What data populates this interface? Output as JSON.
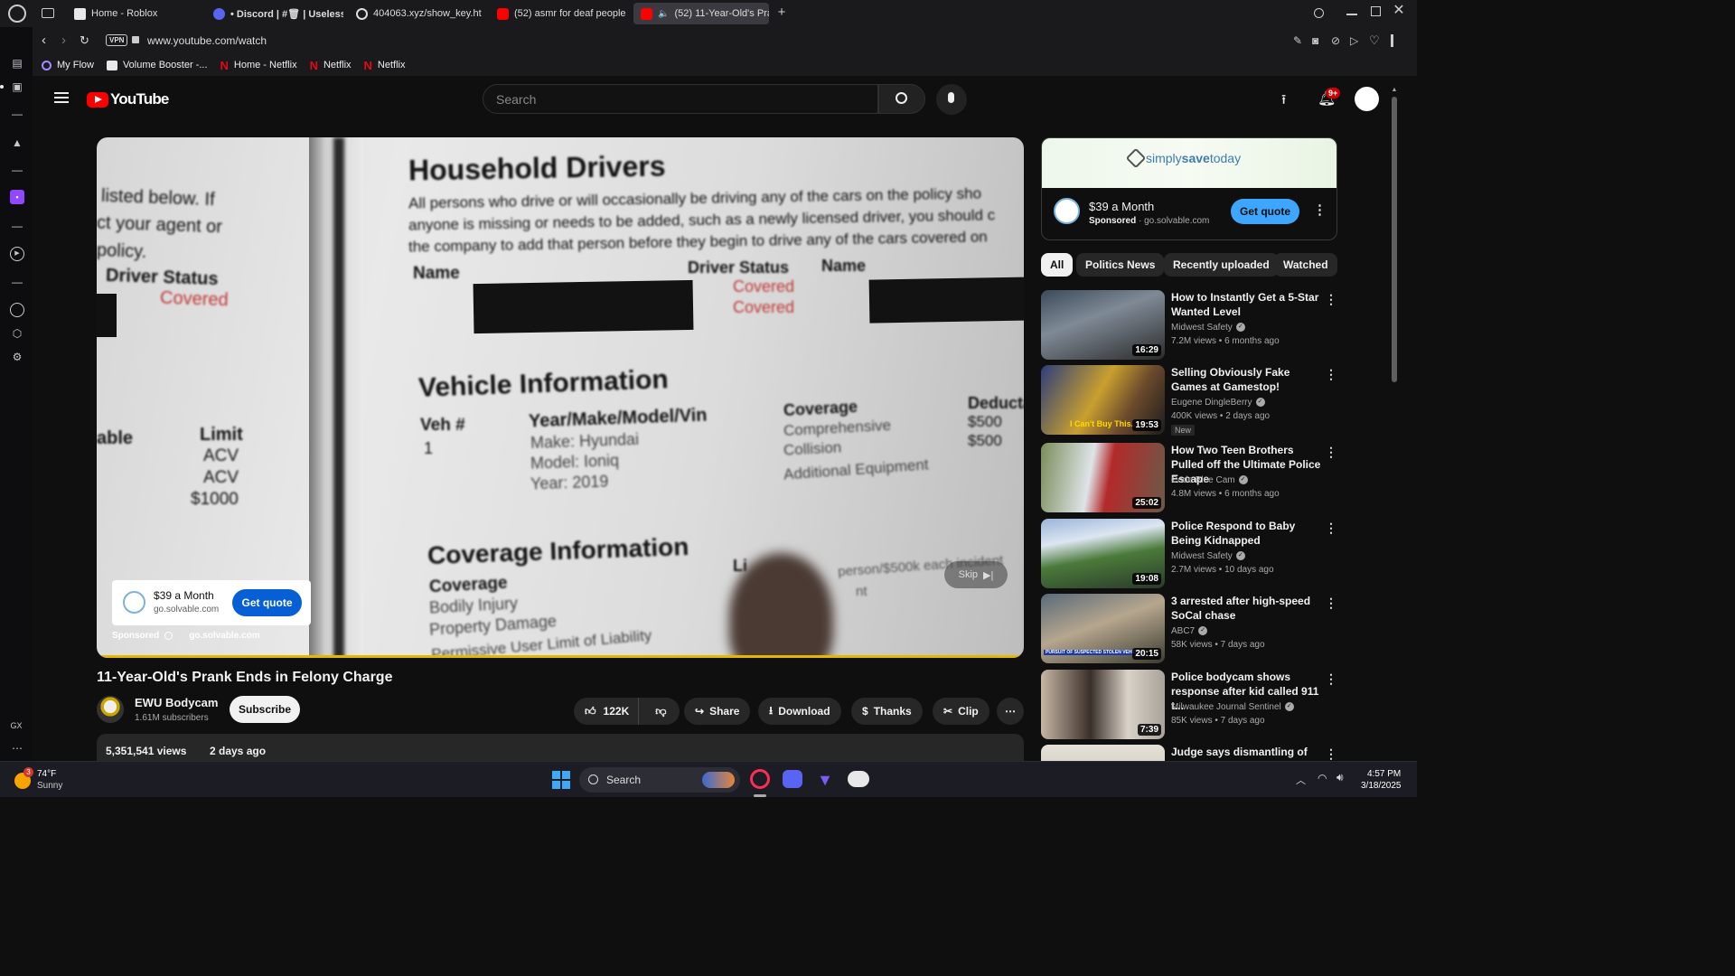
{
  "browser": {
    "tabs": [
      {
        "title": "Home - Roblox"
      },
      {
        "title": "• Discord | #🗑 | Useless-"
      },
      {
        "title": "404063.xyz/show_key.ht"
      },
      {
        "title": "(52) asmr for deaf people"
      },
      {
        "title": "(52) 11-Year-Old's Pra"
      }
    ],
    "address": "www.youtube.com/watch",
    "vpn_label": "VPN",
    "bookmarks": [
      {
        "label": "My Flow"
      },
      {
        "label": "Volume Booster -..."
      },
      {
        "label": "Home - Netflix"
      },
      {
        "label": "Netflix"
      },
      {
        "label": "Netflix"
      }
    ]
  },
  "youtube": {
    "logo_text": "YouTube",
    "search_placeholder": "Search",
    "notification_badge": "9+",
    "video": {
      "doc_title": "Household Drivers",
      "doc_line1": "All persons who drive or will occasionally be driving any of the cars on the policy sho",
      "doc_line2": "anyone is missing or needs to be added, such as a newly licensed driver, you should c",
      "doc_line3": "the company to add that person before they begin to drive any of the cars covered on",
      "left_line1": "listed below. If",
      "left_line2": "ct your agent or",
      "left_line3": "policy.",
      "left_status": "Driver Status",
      "left_covered": "Covered",
      "col_name": "Name",
      "col_status": "Driver Status",
      "col_name2": "Name",
      "covered1": "Covered",
      "covered2": "Covered",
      "vehicle_title": "Vehicle Information",
      "veh_num": "Veh #",
      "veh_one": "1",
      "ymm": "Year/Make/Model/Vin",
      "make": "Make: Hyundai",
      "model": "Model: Ioniq",
      "year": "Year: 2019",
      "coverage_head": "Coverage",
      "cov1": "Comprehensive",
      "cov2": "Collision",
      "cov3": "Additional Equipment",
      "deduct": "Deducta",
      "d1": "$500",
      "d2": "$500",
      "able": "able",
      "limit": "Limit",
      "acv1": "ACV",
      "acv2": "ACV",
      "k1000": "$1000",
      "coverage_info": "Coverage Information",
      "cov_col": "Coverage",
      "bodily": "Bodily Injury",
      "property": "Property Damage",
      "permissive": "Permissive User Limit of Liability",
      "li": "Li",
      "perperson": "person/$500k each incident",
      "nt": "nt",
      "skip_label": "Skip",
      "progress": 1.0
    },
    "ad_overlay": {
      "price": "$39 a Month",
      "domain": "go.solvable.com",
      "cta": "Get quote",
      "sponsored": "Sponsored",
      "url": "go.solvable.com"
    },
    "video_title": "11-Year-Old's Prank Ends in Felony Charge",
    "channel": {
      "name": "EWU Bodycam",
      "subs": "1.61M subscribers",
      "subscribe": "Subscribe"
    },
    "actions": {
      "likes": "122K",
      "share": "Share",
      "download": "Download",
      "thanks": "Thanks",
      "clip": "Clip"
    },
    "description": {
      "views": "5,351,541 views",
      "date": "2 days ago"
    },
    "side_ad": {
      "brand_pre": "simply",
      "brand_bold": "save",
      "brand_post": "today",
      "price": "$39 a Month",
      "sponsored": "Sponsored",
      "domain": "go.solvable.com",
      "cta": "Get quote"
    },
    "chips": [
      {
        "label": "All"
      },
      {
        "label": "Politics News"
      },
      {
        "label": "Recently uploaded"
      },
      {
        "label": "Watched"
      }
    ],
    "recommendations": [
      {
        "title": "How to Instantly Get a 5-Star Wanted Level",
        "channel": "Midwest Safety",
        "meta": "7.2M views  • 6 months ago",
        "duration": "16:29"
      },
      {
        "title": "Selling Obviously Fake Games at Gamestop!",
        "channel": "Eugene DingleBerry",
        "meta": "400K views  • 2 days ago",
        "duration": "19:53",
        "badge": "New",
        "thumb_caption": "I Can't Buy This..."
      },
      {
        "title": "How Two Teen Brothers Pulled off the Ultimate Police Escape",
        "channel": "Code Blue Cam",
        "meta": "4.8M views  • 6 months ago",
        "duration": "25:02"
      },
      {
        "title": "Police Respond to Baby Being Kidnapped",
        "channel": "Midwest Safety",
        "meta": "2.7M views  • 10 days ago",
        "duration": "19:08"
      },
      {
        "title": "3 arrested after high-speed SoCal chase",
        "channel": "ABC7",
        "meta": "58K views  • 7 days ago",
        "duration": "20:15",
        "thumb_caption": "PURSUIT OF SUSPECTED STOLEN VEHICLE"
      },
      {
        "title": "Police bodycam shows response after kid called 911 t...",
        "channel": "Milwaukee Journal Sentinel",
        "meta": "85K views  • 7 days ago",
        "duration": "7:39"
      },
      {
        "title": "Judge says dismantling of",
        "channel": "",
        "meta": "",
        "duration": ""
      }
    ]
  },
  "taskbar": {
    "weather_temp": "74°F",
    "weather_cond": "Sunny",
    "weather_badge": "3",
    "search_label": "Search",
    "time": "4:57 PM",
    "date": "3/18/2025",
    "left_rail_label": "GX"
  },
  "colors": {
    "accent_red": "#ff0000",
    "cta_blue": "#065fd4",
    "progress_yellow": "#e5b800"
  }
}
